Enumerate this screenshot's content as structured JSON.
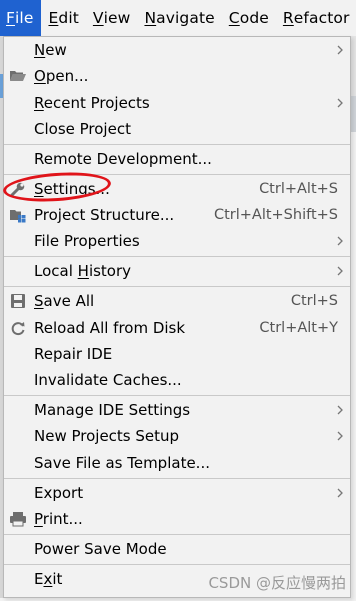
{
  "menubar": {
    "items": [
      {
        "mn": "F",
        "rest": "ile"
      },
      {
        "mn": "E",
        "rest": "dit"
      },
      {
        "mn": "V",
        "rest": "iew"
      },
      {
        "mn": "N",
        "rest": "avigate"
      },
      {
        "mn": "C",
        "rest": "ode"
      },
      {
        "mn": "R",
        "rest": "efactor"
      }
    ]
  },
  "menu": {
    "new": {
      "mn": "N",
      "rest": "ew"
    },
    "open": {
      "mn": "O",
      "rest": "pen..."
    },
    "recent_projects": {
      "mn": "R",
      "rest": "ecent Projects"
    },
    "close_project": {
      "label": "Close Project"
    },
    "remote_development": {
      "label": "Remote Development..."
    },
    "settings": {
      "mn": "S",
      "rest": "ettings...",
      "shortcut": "Ctrl+Alt+S"
    },
    "project_structure": {
      "label": "Project Structure...",
      "shortcut": "Ctrl+Alt+Shift+S"
    },
    "file_properties": {
      "label": "File Properties"
    },
    "local_history": {
      "pre": "Local ",
      "mn": "H",
      "rest": "istory"
    },
    "save_all": {
      "mn": "S",
      "rest": "ave All",
      "shortcut": "Ctrl+S"
    },
    "reload_all": {
      "label": "Reload All from Disk",
      "shortcut": "Ctrl+Alt+Y"
    },
    "repair_ide": {
      "label": "Repair IDE"
    },
    "invalidate_caches": {
      "label": "Invalidate Caches..."
    },
    "manage_ide_settings": {
      "label": "Manage IDE Settings"
    },
    "new_projects_setup": {
      "label": "New Projects Setup"
    },
    "save_file_as_template": {
      "label": "Save File as Template..."
    },
    "export": {
      "label": "Export"
    },
    "print": {
      "mn": "P",
      "rest": "rint..."
    },
    "power_save_mode": {
      "label": "Power Save Mode"
    },
    "exit": {
      "pre": "E",
      "mn": "x",
      "rest": "it"
    }
  },
  "watermark": "CSDN @反应慢两拍",
  "colors": {
    "accent": "#1f62d0",
    "annotation": "#e0141a"
  }
}
